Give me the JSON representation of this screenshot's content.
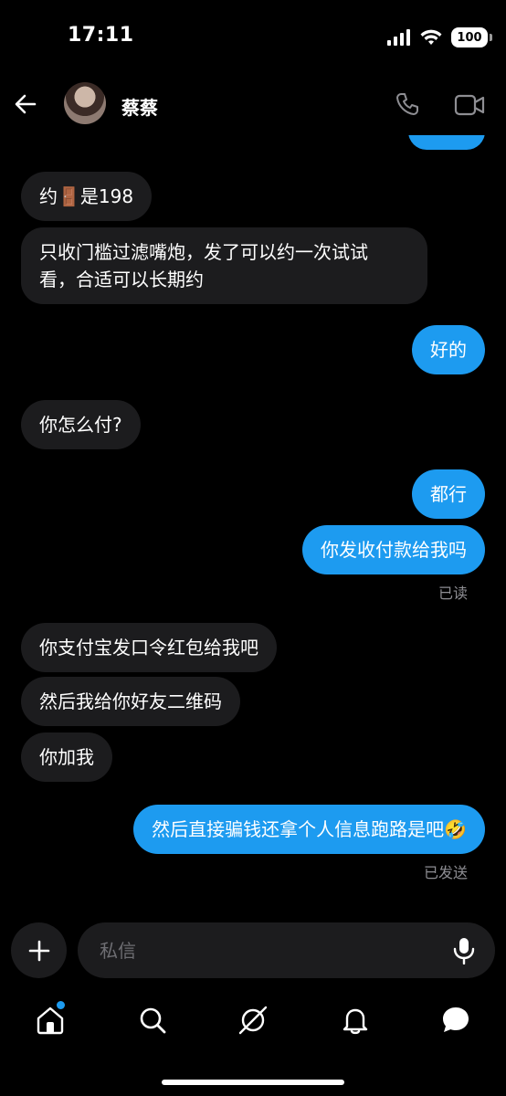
{
  "status_bar": {
    "time": "17:11",
    "battery": "100"
  },
  "header": {
    "contact_name": "蔡蔡"
  },
  "messages": [
    {
      "side": "in",
      "text": "约🚪是198"
    },
    {
      "side": "in",
      "text": "只收门槛过滤嘴炮，发了可以约一次试试",
      "text2": "看，合适可以长期约"
    },
    {
      "side": "out",
      "text": "好的"
    },
    {
      "side": "in",
      "text": "你怎么付?"
    },
    {
      "side": "out",
      "text": "都行"
    },
    {
      "side": "out",
      "text": "你发收付款给我吗"
    },
    {
      "side": "in",
      "text": "你支付宝发口令红包给我吧"
    },
    {
      "side": "in",
      "text": "然后我给你好友二维码"
    },
    {
      "side": "in",
      "text": "你加我"
    },
    {
      "side": "out",
      "text": "然后直接骗钱还拿个人信息跑路是吧🤣"
    }
  ],
  "read_status": "已读",
  "sent_status": "已发送",
  "composer": {
    "placeholder": "私信"
  },
  "colors": {
    "outgoing_bubble": "#1d9bf0",
    "incoming_bubble": "#1c1c1e",
    "background": "#000000"
  },
  "nav": [
    "home-icon",
    "search-icon",
    "explore-icon",
    "notifications-icon",
    "messages-icon"
  ]
}
